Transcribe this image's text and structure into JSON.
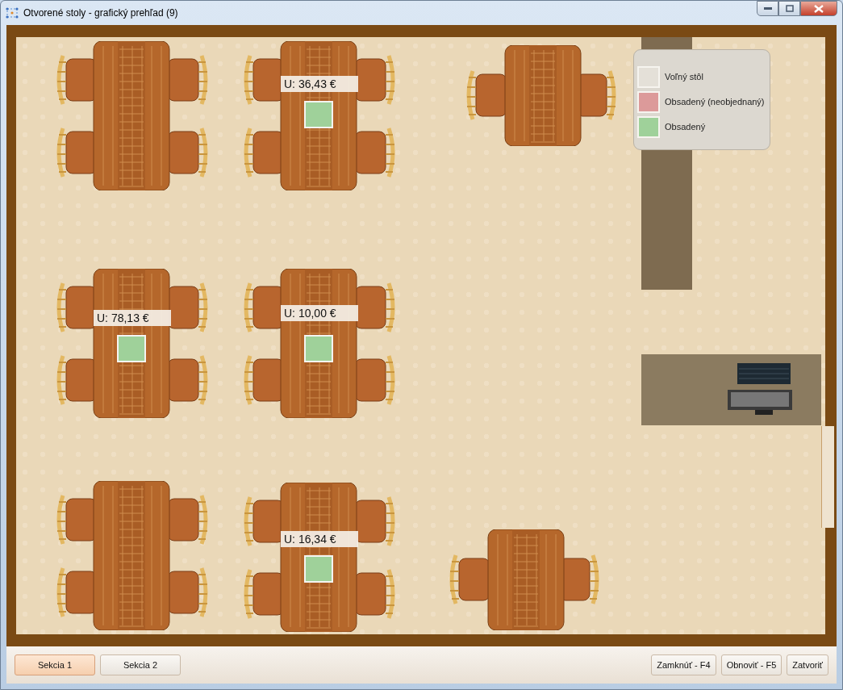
{
  "window": {
    "title": "Otvorené stoly - grafický prehľad (9)"
  },
  "legend": [
    {
      "label": "Voľný stôl",
      "color": "#e4e0d8"
    },
    {
      "label": "Obsadený (neobjednaný)",
      "color": "#dc9a9a"
    },
    {
      "label": "Obsadený",
      "color": "#9fd19a"
    }
  ],
  "tables": [
    {
      "kind": "large",
      "occupied": false
    },
    {
      "kind": "large",
      "occupied": true,
      "amount": "U: 36,43 €"
    },
    {
      "kind": "small",
      "occupied": false
    },
    {
      "kind": "large",
      "occupied": true,
      "amount": "U: 78,13 €"
    },
    {
      "kind": "large",
      "occupied": true,
      "amount": "U: 10,00 €"
    },
    {
      "kind": "large",
      "occupied": false
    },
    {
      "kind": "large",
      "occupied": true,
      "amount": "U: 16,34 €"
    },
    {
      "kind": "small",
      "occupied": false
    }
  ],
  "sections": [
    {
      "label": "Sekcia 1",
      "selected": true
    },
    {
      "label": "Sekcia 2",
      "selected": false
    }
  ],
  "buttons": [
    "Zamknúť - F4",
    "Obnoviť - F5",
    "Zatvoriť"
  ]
}
